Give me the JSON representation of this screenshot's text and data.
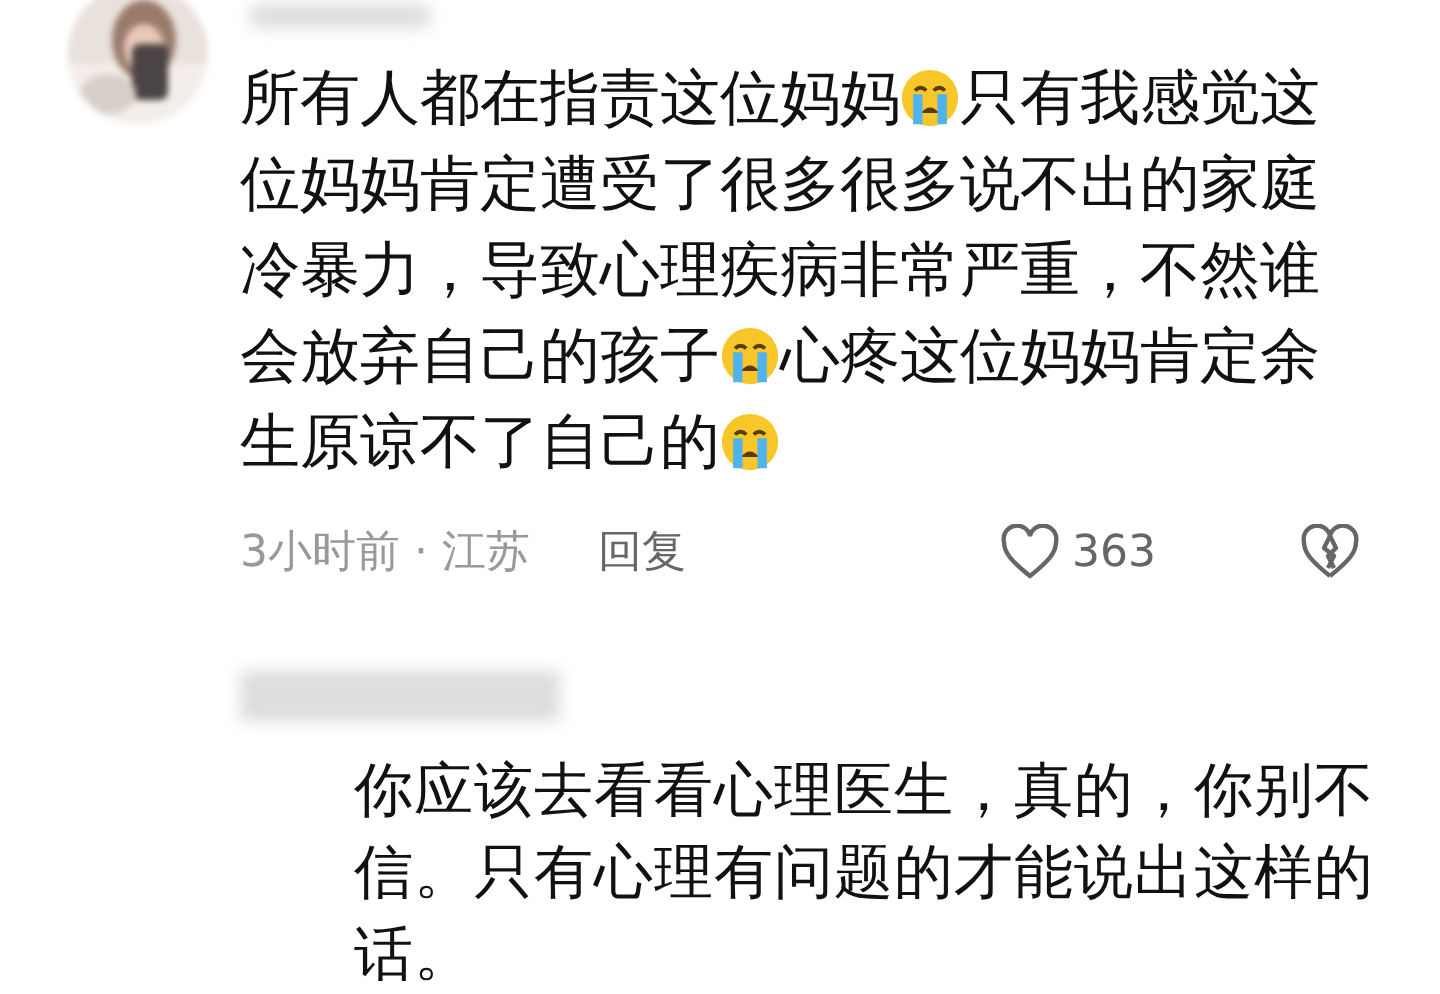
{
  "comment": {
    "avatar": {
      "kind": "picture"
    },
    "lines": [
      [
        {
          "kind": "text",
          "text": "所有人都在指责这位妈妈"
        },
        {
          "kind": "emoji"
        },
        {
          "kind": "text",
          "text": "只有我感觉这"
        }
      ],
      [
        {
          "kind": "text",
          "text": "位妈妈肯定遭受了很多很多说不出的家庭"
        }
      ],
      [
        {
          "kind": "text",
          "text": "冷暴力，导致心理疾病非常严重，不然谁"
        }
      ],
      [
        {
          "kind": "text",
          "text": "会放弃自己的孩子"
        },
        {
          "kind": "emoji"
        },
        {
          "kind": "text",
          "text": "心疼这位妈妈肯定余"
        }
      ],
      [
        {
          "kind": "text",
          "text": "生原谅不了自己的"
        },
        {
          "kind": "emoji"
        }
      ]
    ],
    "time_location": "3小时前 · 江苏",
    "reply_label": "回复",
    "like_count": "363"
  },
  "reply": {
    "lines": [
      "你应该去看看心理医生，真的，你别不",
      "信。只有心理有问题的才能说出这样的",
      "话。"
    ]
  }
}
